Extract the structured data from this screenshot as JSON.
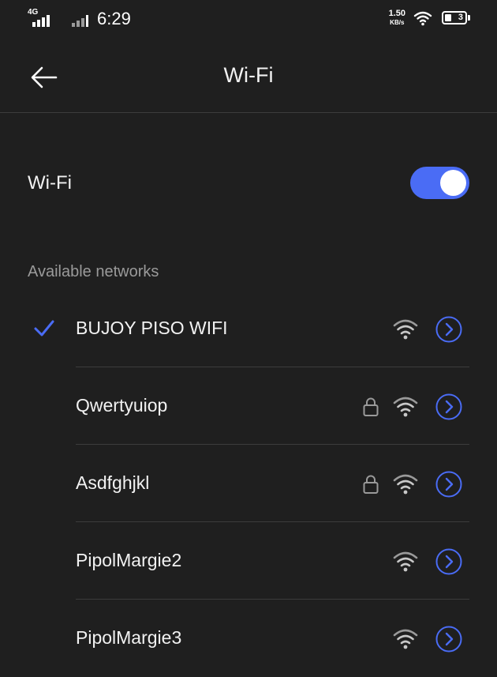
{
  "status_bar": {
    "network_type": "4G",
    "time": "6:29",
    "speed_value": "1.50",
    "speed_unit": "KB/s",
    "battery_level": "3"
  },
  "header": {
    "back_icon": "arrow-left-icon",
    "title": "Wi-Fi"
  },
  "wifi_toggle": {
    "label": "Wi-Fi",
    "enabled": true
  },
  "available_networks": {
    "title": "Available networks",
    "networks": [
      {
        "name": "BUJOY PISO WIFI",
        "connected": true,
        "secured": false
      },
      {
        "name": "Qwertyuiop",
        "connected": false,
        "secured": true
      },
      {
        "name": "Asdfghjkl",
        "connected": false,
        "secured": true
      },
      {
        "name": "PipolMargie2",
        "connected": false,
        "secured": false
      },
      {
        "name": "PipolMargie3",
        "connected": false,
        "secured": false
      }
    ]
  },
  "colors": {
    "background": "#1f1f1f",
    "accent": "#4a6cf5",
    "divider": "#3c3c3c",
    "secondary_text": "#9a9a9a"
  }
}
